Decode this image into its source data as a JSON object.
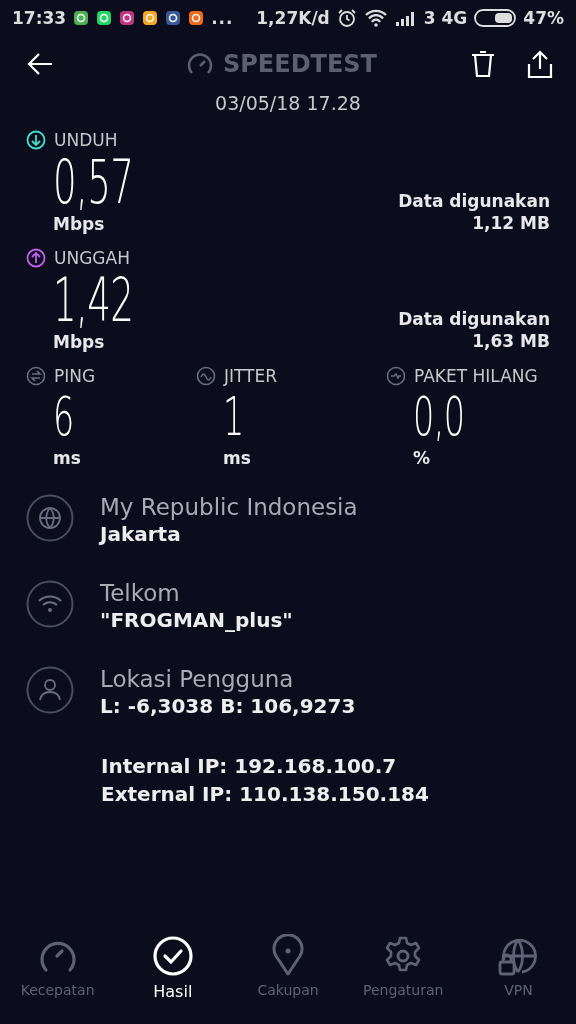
{
  "status_bar": {
    "time": "17:33",
    "more": "...",
    "speed": "1,27K/d",
    "network": "3 4G",
    "battery": "47%"
  },
  "header": {
    "title": "SPEEDTEST",
    "datetime": "03/05/18 17.28"
  },
  "results": [
    {
      "kind": "download",
      "label": "UNDUH",
      "color": "#3ee0d0",
      "value": "0,57",
      "unit": "Mbps",
      "data_label": "Data digunakan",
      "data_value": "1,12 MB"
    },
    {
      "kind": "upload",
      "label": "UNGGAH",
      "color": "#c05ef0",
      "value": "1,42",
      "unit": "Mbps",
      "data_label": "Data digunakan",
      "data_value": "1,63 MB"
    }
  ],
  "metrics": [
    {
      "kind": "ping",
      "label": "PING",
      "value": "6",
      "unit": "ms"
    },
    {
      "kind": "jitter",
      "label": "JITTER",
      "value": "1",
      "unit": "ms"
    },
    {
      "kind": "loss",
      "label": "PAKET HILANG",
      "value": "0,0",
      "unit": "%"
    }
  ],
  "info": [
    {
      "kind": "globe",
      "title": "My Republic Indonesia",
      "subtitle": "Jakarta"
    },
    {
      "kind": "wifi",
      "title": "Telkom",
      "subtitle": "\"FROGMAN_plus\""
    },
    {
      "kind": "user",
      "title": "Lokasi Pengguna",
      "subtitle": "L: -6,3038 B: 106,9273"
    }
  ],
  "ip": [
    "Internal IP: 192.168.100.7",
    "External IP: 110.138.150.184"
  ],
  "nav": [
    {
      "kind": "speed",
      "label": "Kecepatan",
      "selected": false
    },
    {
      "kind": "results",
      "label": "Hasil",
      "selected": true
    },
    {
      "kind": "coverage",
      "label": "Cakupan",
      "selected": false
    },
    {
      "kind": "settings",
      "label": "Pengaturan",
      "selected": false
    },
    {
      "kind": "vpn",
      "label": "VPN",
      "selected": false
    }
  ]
}
